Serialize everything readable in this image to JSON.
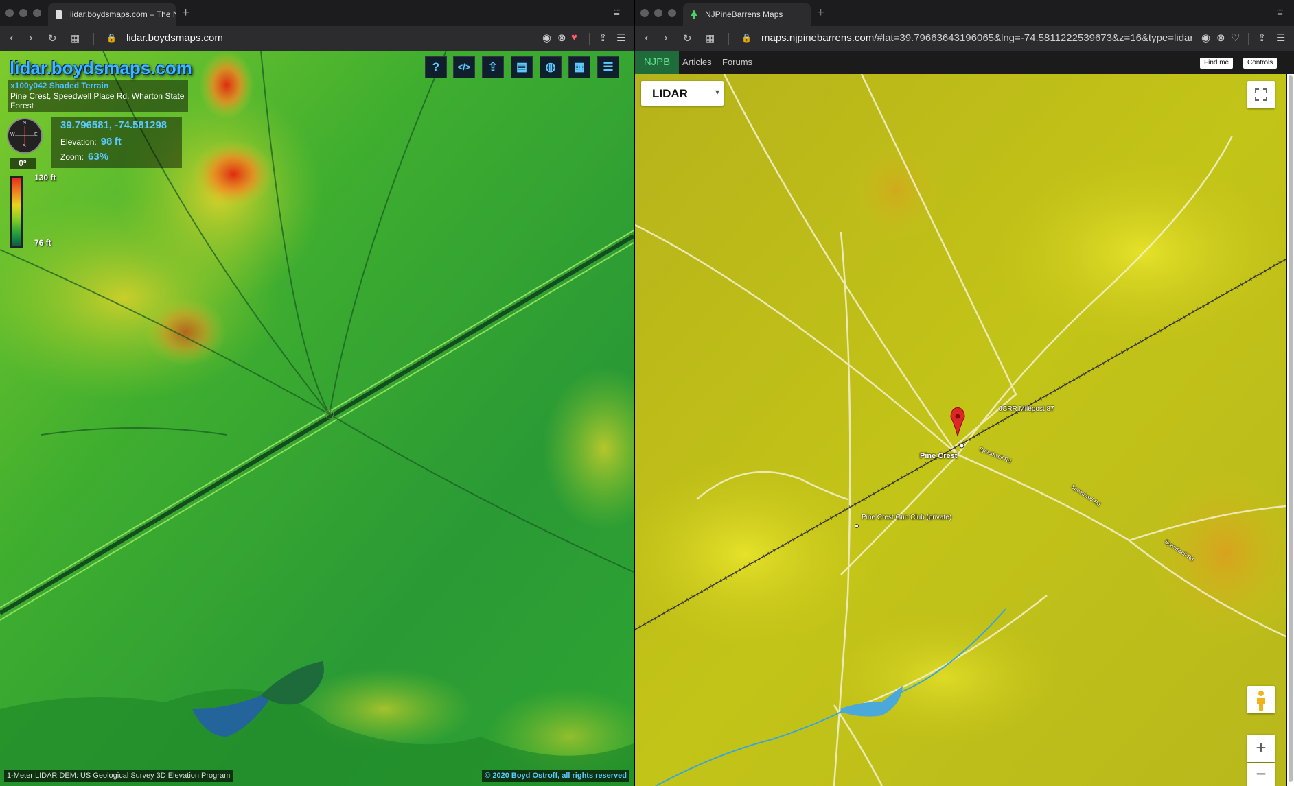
{
  "left_window": {
    "tab_title": "lidar.boydsmaps.com – The N",
    "url": "lidar.boydsmaps.com",
    "brand": "lidar.boydsmaps.com",
    "layer_name": "x100y042 Shaded Terrain",
    "location": "Pine Crest, Speedwell Place Rd, Wharton State Forest",
    "coordinates": "39.796581, -74.581298",
    "elevation_label": "Elevation:",
    "elevation_value": "98",
    "elevation_unit": "ft",
    "zoom_label": "Zoom:",
    "zoom_value": "63%",
    "compass_heading": "0°",
    "compass_letters": {
      "n": "N",
      "e": "E",
      "s": "S",
      "w": "W"
    },
    "legend_max": "130 ft",
    "legend_min": "76 ft",
    "toolbar_icons": [
      "help-icon",
      "embed-code-icon",
      "share-icon",
      "document-icon",
      "globe-icon",
      "grid-icon",
      "settings-sliders-icon"
    ],
    "toolbar_glyphs": {
      "help": "?",
      "code": "</>"
    },
    "footer_left": "1-Meter LIDAR DEM: US Geological Survey 3D Elevation Program",
    "footer_right": "© 2020 Boyd Ostroff, all rights reserved"
  },
  "right_window": {
    "tab_title": "NJPineBarrens Maps",
    "url_host": "maps.njpinebarrens.com",
    "url_rest": "/#lat=39.79663643196065&lng=-74.5811222539673&z=16&type=lidar",
    "nav": {
      "brand": "NJPB",
      "articles": "Articles",
      "forums": "Forums",
      "find_me": "Find me",
      "controls": "Controls"
    },
    "layer_select": "LIDAR",
    "map_labels": {
      "place": "Pine Crest",
      "milepost": "JCRR Milepost 87",
      "gun_club": "Pine Crest Gun Club (private)",
      "road1": "Speedwell Rd",
      "road2": "Speedwell Rd",
      "road3": "Speedwell Rd"
    },
    "zoom_in": "+",
    "zoom_out": "−"
  },
  "colors": {
    "accent_blue": "#3fb6ff",
    "njpb_green": "#206b3a",
    "marker_red": "#e02525"
  }
}
